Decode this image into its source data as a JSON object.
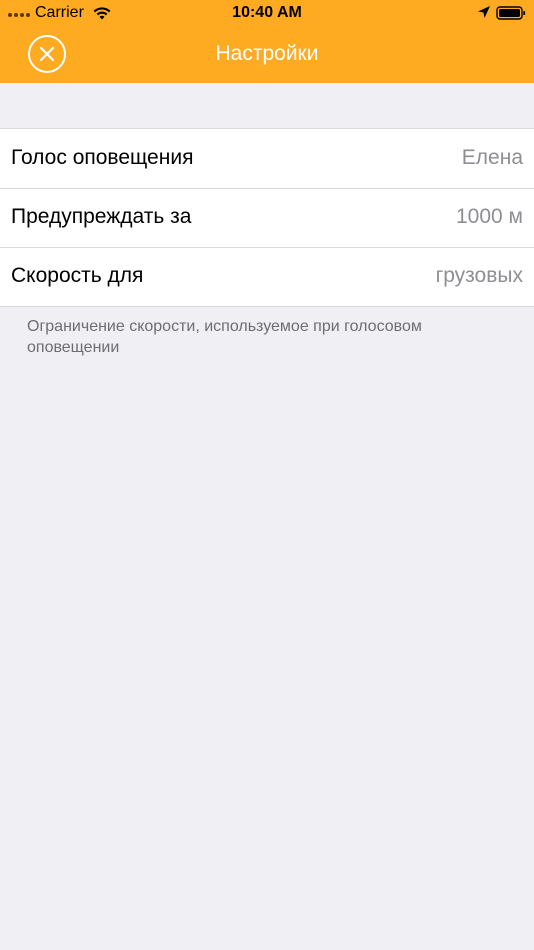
{
  "status_bar": {
    "carrier": "Carrier",
    "time": "10:40 AM",
    "icons": [
      "signal-dots-icon",
      "wifi-icon",
      "location-arrow-icon",
      "battery-icon"
    ]
  },
  "nav": {
    "title": "Настройки",
    "close_icon": "close-circle-icon",
    "background_color": "#ffab22",
    "text_color": "#ffffff"
  },
  "settings": {
    "rows": [
      {
        "label": "Голос оповещения",
        "value": "Елена"
      },
      {
        "label": "Предупреждать за",
        "value": "1000 м"
      },
      {
        "label": "Скорость для",
        "value": "грузовых"
      }
    ],
    "footer": "Ограничение скорости, используемое при голосовом оповещении"
  }
}
